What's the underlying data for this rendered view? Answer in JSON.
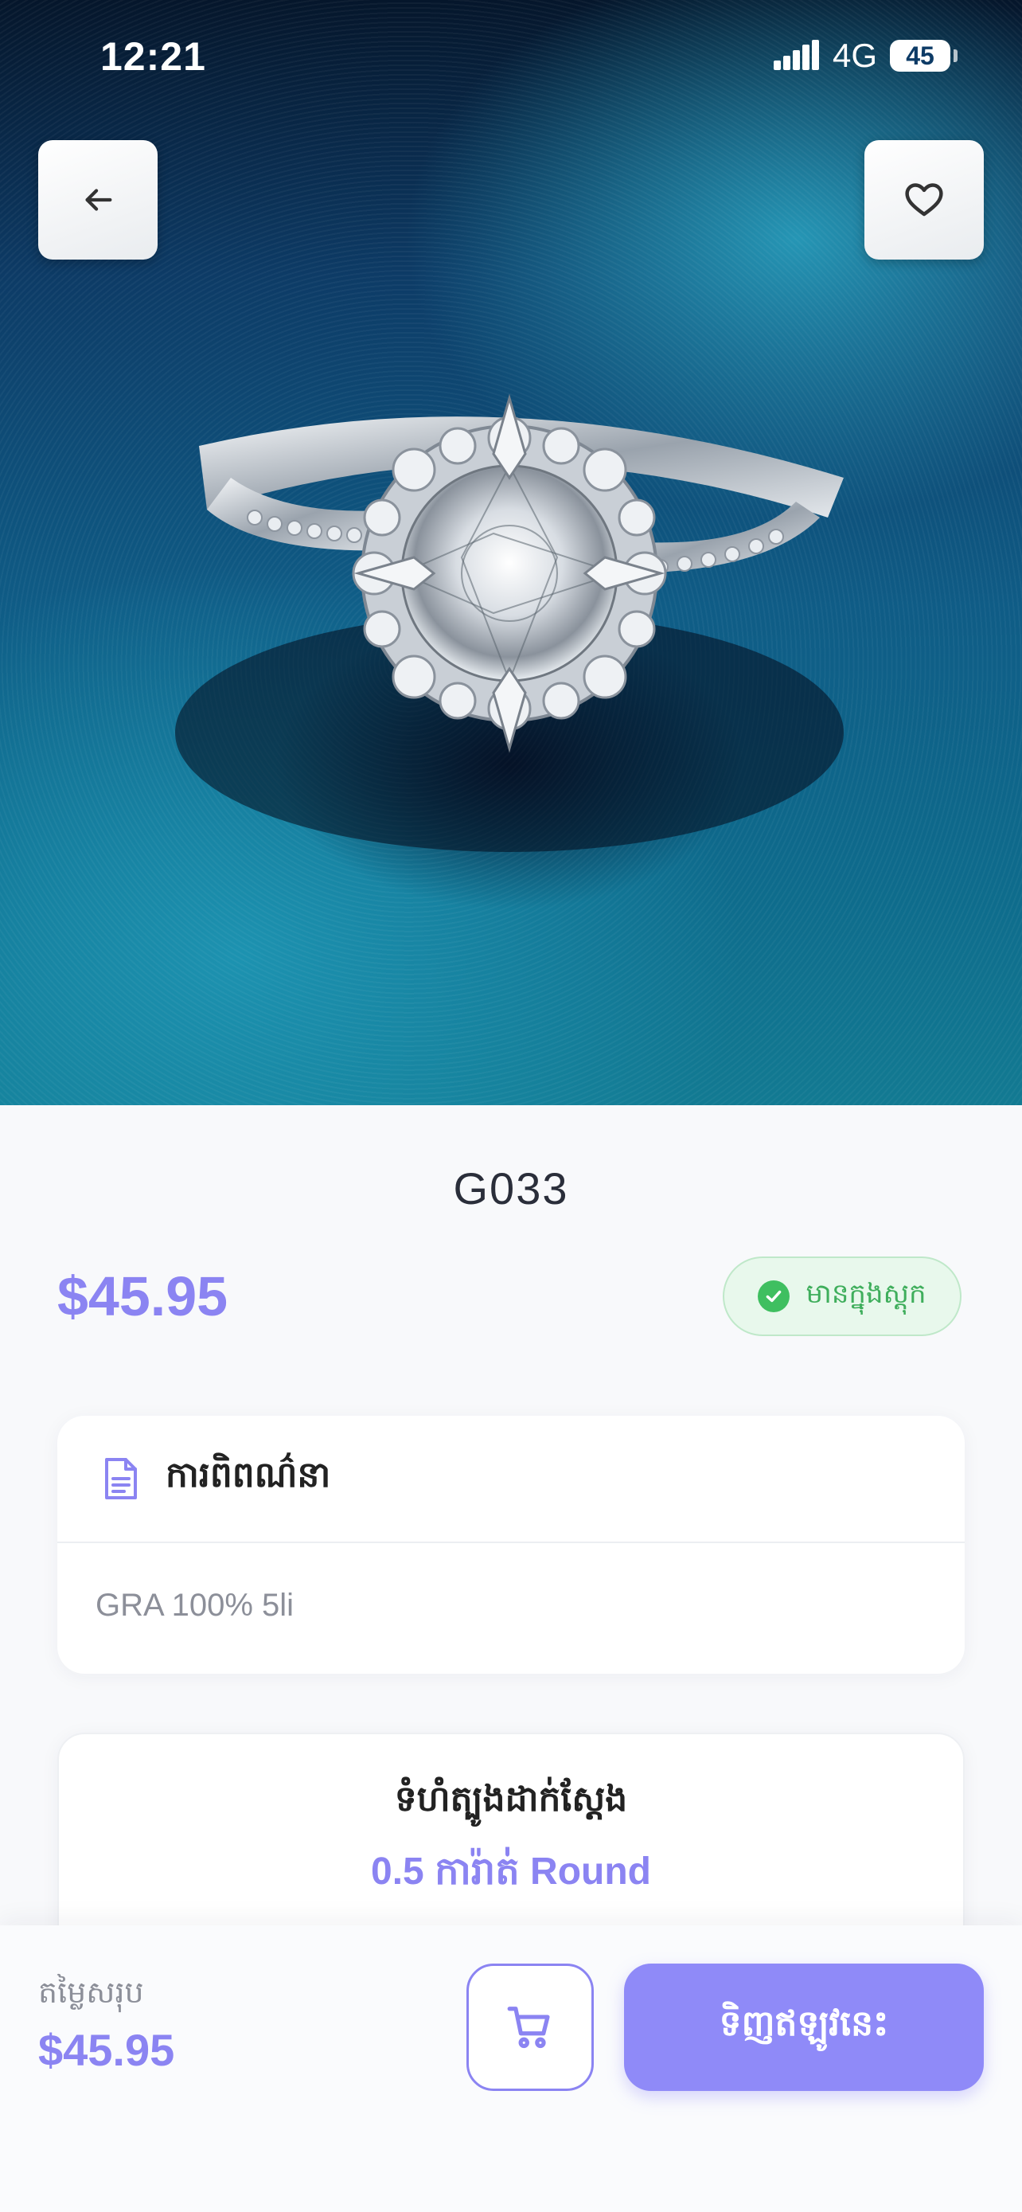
{
  "status_bar": {
    "time": "12:21",
    "network": "4G",
    "battery": "45"
  },
  "product": {
    "title": "G033",
    "price": "$45.95",
    "stock_label": "មានក្នុងស្តុក",
    "description_title": "ការពិពណ៌នា",
    "description_text": "GRA 100% 5li",
    "stone_size_title": "ទំហំត្បូងដាក់ស្តែង",
    "stone_size_value": "0.5 ការ៉ាត់ Round"
  },
  "bottom_bar": {
    "total_label": "តម្លៃសរុប",
    "total_value": "$45.95",
    "buy_label": "ទិញឥឡូវនេះ"
  },
  "colors": {
    "accent": "#8b84f2",
    "in_stock_green": "#3fbf60",
    "button": "#8f8af8"
  }
}
